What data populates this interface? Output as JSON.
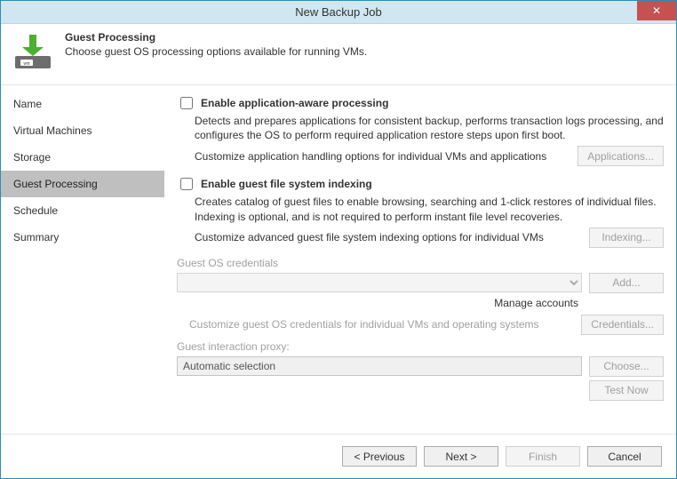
{
  "window": {
    "title": "New Backup Job"
  },
  "header": {
    "title": "Guest Processing",
    "subtitle": "Choose guest OS processing options available for running VMs."
  },
  "sidebar": {
    "items": [
      {
        "label": "Name"
      },
      {
        "label": "Virtual Machines"
      },
      {
        "label": "Storage"
      },
      {
        "label": "Guest Processing"
      },
      {
        "label": "Schedule"
      },
      {
        "label": "Summary"
      }
    ],
    "activeIndex": 3
  },
  "app_aware": {
    "label": "Enable application-aware processing",
    "desc": "Detects and prepares applications for consistent backup, performs transaction logs processing, and configures the OS to perform required application restore steps upon first boot.",
    "customize_text": "Customize application handling options for individual VMs and applications",
    "button": "Applications..."
  },
  "indexing": {
    "label": "Enable guest file system indexing",
    "desc": "Creates catalog of guest files to enable browsing, searching and 1-click restores of individual files. Indexing is optional, and is not required to perform instant file level recoveries.",
    "customize_text": "Customize advanced guest file system indexing options for individual VMs",
    "button": "Indexing..."
  },
  "credentials": {
    "group_label": "Guest OS credentials",
    "add_button": "Add...",
    "manage_link": "Manage accounts",
    "customize_text": "Customize guest OS credentials for individual VMs and operating systems",
    "credentials_button": "Credentials..."
  },
  "proxy": {
    "label": "Guest interaction proxy:",
    "value": "Automatic selection",
    "choose_button": "Choose...",
    "test_button": "Test Now"
  },
  "footer": {
    "previous": "< Previous",
    "next": "Next >",
    "finish": "Finish",
    "cancel": "Cancel"
  }
}
